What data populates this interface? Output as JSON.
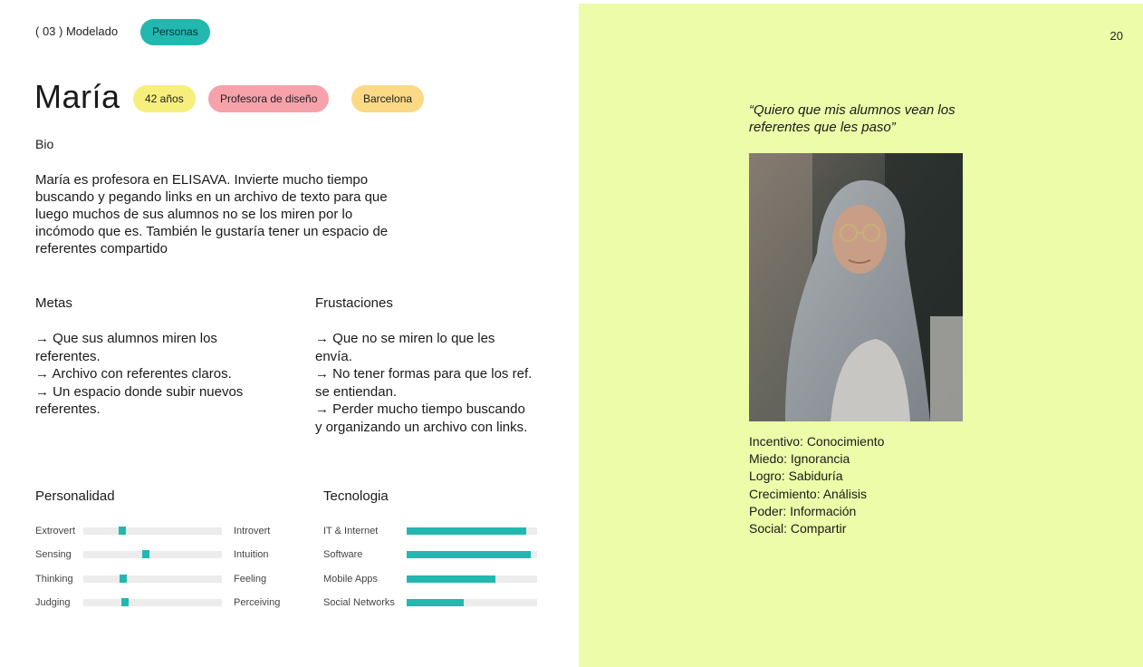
{
  "breadcrumb": "( 03 ) Modelado",
  "section_pill": "Personas",
  "persona": {
    "name": "María",
    "age": "42 años",
    "role": "Profesora de diseño",
    "city": "Barcelona"
  },
  "bio": {
    "heading": "Bio",
    "text": "María es profesora en ELISAVA. Invierte mucho tiempo buscando y pegando links en un archivo de texto para que luego muchos de sus alumnos no se los miren por lo incómodo que es. También le gustaría tener un espacio de referentes compartido"
  },
  "goals": {
    "heading": "Metas",
    "items": [
      "→ Que sus alumnos miren los referentes.",
      "→ Archivo con referentes claros.",
      "→ Un espacio donde subir nuevos referentes."
    ]
  },
  "frustrations": {
    "heading": "Frustaciones",
    "items": [
      "→ Que no se miren lo que les envía.",
      "→ No tener formas para que los ref. se entiendan.",
      "→ Perder mucho tiempo buscando y organizando un archivo con links."
    ]
  },
  "personality": {
    "heading": "Personalidad",
    "traits": [
      {
        "left": "Extrovert",
        "right": "Introvert",
        "value": 0.28
      },
      {
        "left": "Sensing",
        "right": "Intuition",
        "value": 0.45
      },
      {
        "left": "Thinking",
        "right": "Feeling",
        "value": 0.29
      },
      {
        "left": "Judging",
        "right": "Perceiving",
        "value": 0.3
      }
    ]
  },
  "technology": {
    "heading": "Tecnologia",
    "items": [
      {
        "label": "IT & Internet",
        "value": 0.92
      },
      {
        "label": "Software",
        "value": 0.95
      },
      {
        "label": "Mobile Apps",
        "value": 0.68
      },
      {
        "label": "Social Networks",
        "value": 0.44
      }
    ]
  },
  "page_number": "20",
  "quote": "“Quiero que mis alumnos vean los referentes que les paso”",
  "attributes": [
    "Incentivo: Conocimiento",
    "Miedo: Ignorancia",
    "Logro: Sabiduría",
    "Crecimiento: Análisis",
    "Poder: Información",
    "Social: Compartir"
  ],
  "colors": {
    "accent": "#22b8b0",
    "right_panel": "#ecfca8",
    "tag_age": "#f7ef7c",
    "tag_role": "#f7a1ab",
    "tag_city": "#fcd985"
  }
}
